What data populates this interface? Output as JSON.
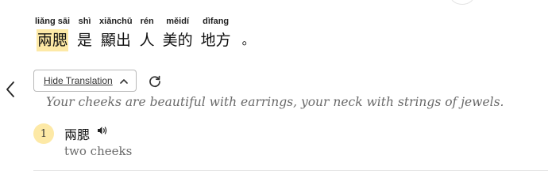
{
  "sentence": {
    "words": [
      {
        "pinyin": "liǎng sāi",
        "hanzi": "兩腮"
      },
      {
        "pinyin": "shì",
        "hanzi": "是"
      },
      {
        "pinyin": "xiǎnchū",
        "hanzi": "顯出"
      },
      {
        "pinyin": "rén",
        "hanzi": "人"
      },
      {
        "pinyin": "měidí",
        "hanzi": "美的"
      },
      {
        "pinyin": "dìfang",
        "hanzi": "地方"
      },
      {
        "pinyin": "",
        "hanzi": "。"
      }
    ],
    "highlighted_word_index": 0
  },
  "toolbar": {
    "toggle_label": "Hide Translation",
    "back_icon": "chevron-left-icon",
    "toggle_icon": "chevron-up-icon",
    "refresh_icon": "refresh-icon"
  },
  "translation": "Your cheeks are beautiful with earrings, your neck with strings of jewels.",
  "vocab": {
    "number": "1",
    "word": "兩腮",
    "audio_icon": "speaker-icon",
    "definition": "two cheeks"
  },
  "colors": {
    "highlight": "#fde9a6",
    "translation_text": "#6a6a6a",
    "border": "#b9b9b9"
  }
}
